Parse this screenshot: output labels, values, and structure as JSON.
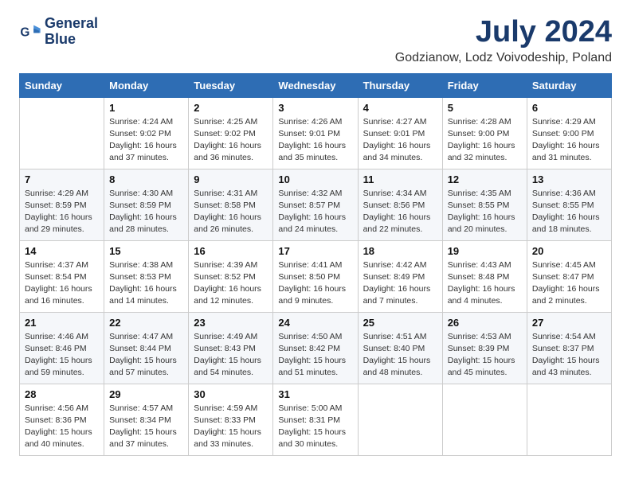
{
  "header": {
    "logo_line1": "General",
    "logo_line2": "Blue",
    "month_year": "July 2024",
    "location": "Godzianow, Lodz Voivodeship, Poland"
  },
  "weekdays": [
    "Sunday",
    "Monday",
    "Tuesday",
    "Wednesday",
    "Thursday",
    "Friday",
    "Saturday"
  ],
  "weeks": [
    [
      {
        "day": "",
        "info": ""
      },
      {
        "day": "1",
        "info": "Sunrise: 4:24 AM\nSunset: 9:02 PM\nDaylight: 16 hours\nand 37 minutes."
      },
      {
        "day": "2",
        "info": "Sunrise: 4:25 AM\nSunset: 9:02 PM\nDaylight: 16 hours\nand 36 minutes."
      },
      {
        "day": "3",
        "info": "Sunrise: 4:26 AM\nSunset: 9:01 PM\nDaylight: 16 hours\nand 35 minutes."
      },
      {
        "day": "4",
        "info": "Sunrise: 4:27 AM\nSunset: 9:01 PM\nDaylight: 16 hours\nand 34 minutes."
      },
      {
        "day": "5",
        "info": "Sunrise: 4:28 AM\nSunset: 9:00 PM\nDaylight: 16 hours\nand 32 minutes."
      },
      {
        "day": "6",
        "info": "Sunrise: 4:29 AM\nSunset: 9:00 PM\nDaylight: 16 hours\nand 31 minutes."
      }
    ],
    [
      {
        "day": "7",
        "info": "Sunrise: 4:29 AM\nSunset: 8:59 PM\nDaylight: 16 hours\nand 29 minutes."
      },
      {
        "day": "8",
        "info": "Sunrise: 4:30 AM\nSunset: 8:59 PM\nDaylight: 16 hours\nand 28 minutes."
      },
      {
        "day": "9",
        "info": "Sunrise: 4:31 AM\nSunset: 8:58 PM\nDaylight: 16 hours\nand 26 minutes."
      },
      {
        "day": "10",
        "info": "Sunrise: 4:32 AM\nSunset: 8:57 PM\nDaylight: 16 hours\nand 24 minutes."
      },
      {
        "day": "11",
        "info": "Sunrise: 4:34 AM\nSunset: 8:56 PM\nDaylight: 16 hours\nand 22 minutes."
      },
      {
        "day": "12",
        "info": "Sunrise: 4:35 AM\nSunset: 8:55 PM\nDaylight: 16 hours\nand 20 minutes."
      },
      {
        "day": "13",
        "info": "Sunrise: 4:36 AM\nSunset: 8:55 PM\nDaylight: 16 hours\nand 18 minutes."
      }
    ],
    [
      {
        "day": "14",
        "info": "Sunrise: 4:37 AM\nSunset: 8:54 PM\nDaylight: 16 hours\nand 16 minutes."
      },
      {
        "day": "15",
        "info": "Sunrise: 4:38 AM\nSunset: 8:53 PM\nDaylight: 16 hours\nand 14 minutes."
      },
      {
        "day": "16",
        "info": "Sunrise: 4:39 AM\nSunset: 8:52 PM\nDaylight: 16 hours\nand 12 minutes."
      },
      {
        "day": "17",
        "info": "Sunrise: 4:41 AM\nSunset: 8:50 PM\nDaylight: 16 hours\nand 9 minutes."
      },
      {
        "day": "18",
        "info": "Sunrise: 4:42 AM\nSunset: 8:49 PM\nDaylight: 16 hours\nand 7 minutes."
      },
      {
        "day": "19",
        "info": "Sunrise: 4:43 AM\nSunset: 8:48 PM\nDaylight: 16 hours\nand 4 minutes."
      },
      {
        "day": "20",
        "info": "Sunrise: 4:45 AM\nSunset: 8:47 PM\nDaylight: 16 hours\nand 2 minutes."
      }
    ],
    [
      {
        "day": "21",
        "info": "Sunrise: 4:46 AM\nSunset: 8:46 PM\nDaylight: 15 hours\nand 59 minutes."
      },
      {
        "day": "22",
        "info": "Sunrise: 4:47 AM\nSunset: 8:44 PM\nDaylight: 15 hours\nand 57 minutes."
      },
      {
        "day": "23",
        "info": "Sunrise: 4:49 AM\nSunset: 8:43 PM\nDaylight: 15 hours\nand 54 minutes."
      },
      {
        "day": "24",
        "info": "Sunrise: 4:50 AM\nSunset: 8:42 PM\nDaylight: 15 hours\nand 51 minutes."
      },
      {
        "day": "25",
        "info": "Sunrise: 4:51 AM\nSunset: 8:40 PM\nDaylight: 15 hours\nand 48 minutes."
      },
      {
        "day": "26",
        "info": "Sunrise: 4:53 AM\nSunset: 8:39 PM\nDaylight: 15 hours\nand 45 minutes."
      },
      {
        "day": "27",
        "info": "Sunrise: 4:54 AM\nSunset: 8:37 PM\nDaylight: 15 hours\nand 43 minutes."
      }
    ],
    [
      {
        "day": "28",
        "info": "Sunrise: 4:56 AM\nSunset: 8:36 PM\nDaylight: 15 hours\nand 40 minutes."
      },
      {
        "day": "29",
        "info": "Sunrise: 4:57 AM\nSunset: 8:34 PM\nDaylight: 15 hours\nand 37 minutes."
      },
      {
        "day": "30",
        "info": "Sunrise: 4:59 AM\nSunset: 8:33 PM\nDaylight: 15 hours\nand 33 minutes."
      },
      {
        "day": "31",
        "info": "Sunrise: 5:00 AM\nSunset: 8:31 PM\nDaylight: 15 hours\nand 30 minutes."
      },
      {
        "day": "",
        "info": ""
      },
      {
        "day": "",
        "info": ""
      },
      {
        "day": "",
        "info": ""
      }
    ]
  ]
}
